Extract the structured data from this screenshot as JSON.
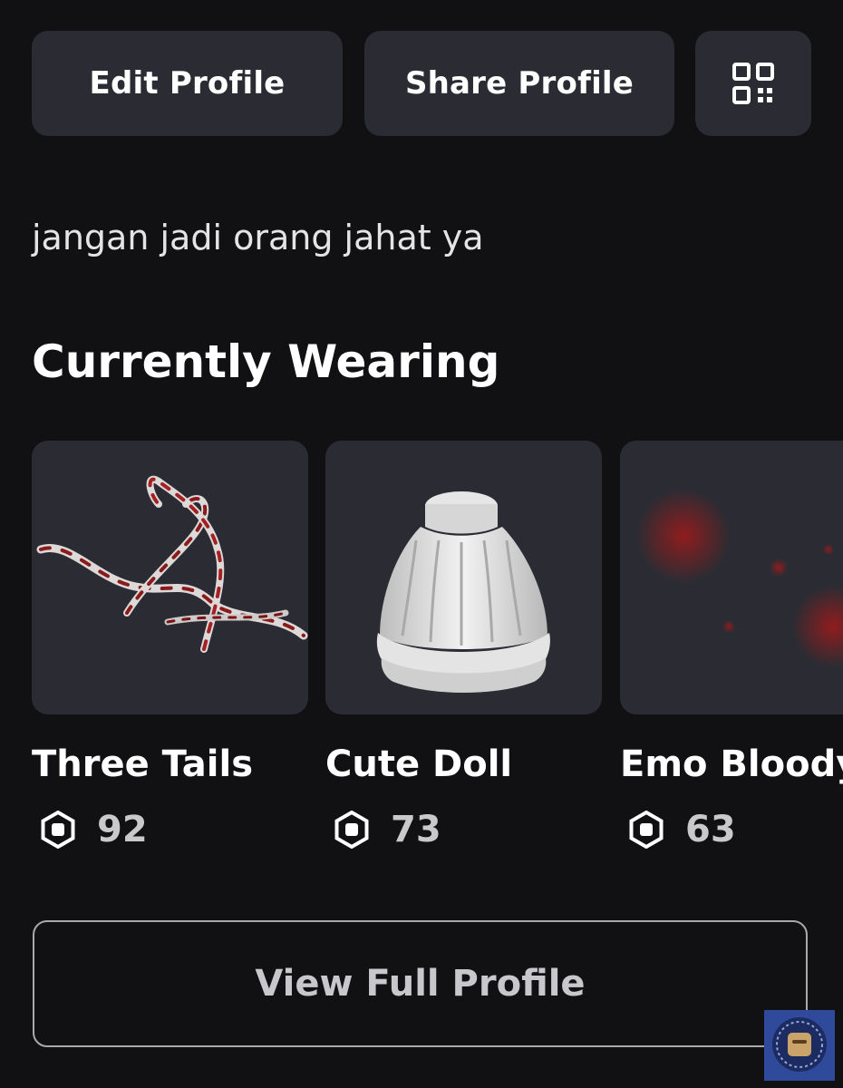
{
  "buttons": {
    "edit_profile": "Edit Profile",
    "share_profile": "Share Profile",
    "qr_icon": "qr-code-icon"
  },
  "bio": "jangan jadi orang jahat ya",
  "currently_wearing": {
    "title": "Currently Wearing",
    "items": [
      {
        "name": "Three Tails",
        "price": "92"
      },
      {
        "name": "Cute Doll",
        "price": "73"
      },
      {
        "name": "Emo Bloody",
        "price": "63"
      }
    ]
  },
  "view_full_profile": "View Full Profile",
  "icons": {
    "currency": "robux-icon"
  },
  "colors": {
    "background": "#111114",
    "card": "#2b2c33",
    "text": "#ffffff",
    "muted": "#c8c8cc",
    "accent_red": "#9b1b1b"
  }
}
